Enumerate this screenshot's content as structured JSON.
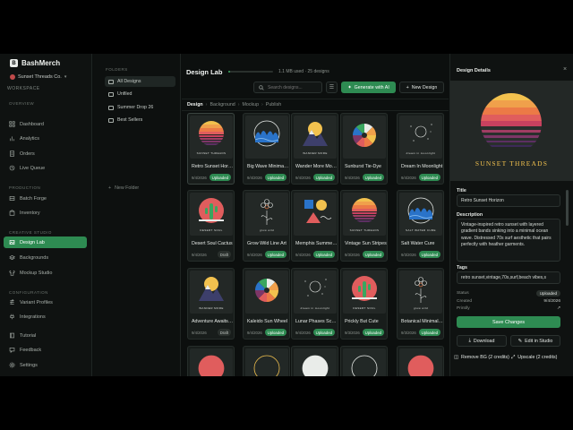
{
  "app": {
    "name": "BashMerch",
    "store": "Sunset Threads Co.",
    "workspace": "WORKSPACE"
  },
  "sidebar": {
    "sections": [
      {
        "label": "OVERVIEW",
        "items": [
          {
            "label": "Dashboard",
            "icon": "grid-icon"
          },
          {
            "label": "Analytics",
            "icon": "chart-icon"
          },
          {
            "label": "Orders",
            "icon": "orders-icon"
          },
          {
            "label": "Live Queue",
            "icon": "queue-icon"
          }
        ]
      },
      {
        "label": "PRODUCTION",
        "items": [
          {
            "label": "Batch Forge",
            "icon": "forge-icon"
          },
          {
            "label": "Inventory",
            "icon": "box-icon"
          }
        ]
      },
      {
        "label": "CREATIVE STUDIO",
        "items": [
          {
            "label": "Design Lab",
            "icon": "image-icon"
          },
          {
            "label": "Backgrounds",
            "icon": "layers-icon"
          },
          {
            "label": "Mockup Studio",
            "icon": "shirt-icon"
          }
        ]
      },
      {
        "label": "CONFIGURATION",
        "items": [
          {
            "label": "Variant Profiles",
            "icon": "sliders-icon"
          },
          {
            "label": "Integrations",
            "icon": "plug-icon"
          }
        ]
      }
    ],
    "bottom": [
      {
        "label": "Tutorial",
        "icon": "book-icon"
      },
      {
        "label": "Feedback",
        "icon": "chat-icon"
      },
      {
        "label": "Settings",
        "icon": "gear-icon"
      }
    ],
    "active": "Design Lab"
  },
  "folders": {
    "title": "FOLDERS",
    "items": [
      {
        "label": "All Designs",
        "icon": "grid-icon"
      },
      {
        "label": "Unfiled",
        "icon": "folder-icon"
      },
      {
        "label": "Summer Drop 26",
        "icon": "folder-icon"
      },
      {
        "label": "Best Sellers",
        "icon": "folder-icon"
      }
    ],
    "new_label": "New Folder"
  },
  "main": {
    "title": "Design Lab",
    "usage": "1.1 MB used · 25 designs",
    "usage_fraction": 0.03,
    "search_placeholder": "Search designs...",
    "generate_label": "Generate with AI",
    "new_design_label": "New Design",
    "breadcrumb": [
      "Design",
      "Background",
      "Mockup",
      "Publish"
    ]
  },
  "designs": [
    {
      "title": "Retro Sunset Horizon",
      "date": "9/4/2026",
      "status": "Uploaded",
      "art": "sunset",
      "caption": "SUNSET THREADS",
      "bg": "#232826"
    },
    {
      "title": "Big Wave Minimalist",
      "date": "9/4/2026",
      "status": "Uploaded",
      "art": "wave",
      "caption": "",
      "bg": "#232826"
    },
    {
      "title": "Wander More Mountains",
      "date": "9/4/2026",
      "status": "Uploaded",
      "art": "mountain",
      "caption": "WANDER MORE",
      "bg": "#232826"
    },
    {
      "title": "Sunburst Tie-Dye",
      "date": "9/4/2026",
      "status": "Uploaded",
      "art": "sunburst",
      "caption": "",
      "bg": "#232826"
    },
    {
      "title": "Dream In Moonlight",
      "date": "9/4/2026",
      "status": "Uploaded",
      "art": "moon",
      "caption": "dream in moonlight",
      "bg": "#232826"
    },
    {
      "title": "Desert Soul Cactus",
      "date": "9/4/2026",
      "status": "Draft",
      "art": "cactus",
      "caption": "DESERT SOUL",
      "bg": "#232826"
    },
    {
      "title": "Grow Wild Line Art",
      "date": "9/4/2026",
      "status": "Uploaded",
      "art": "flower",
      "caption": "grow wild",
      "bg": "#232826"
    },
    {
      "title": "Memphis Summer Shapes",
      "date": "9/4/2026",
      "status": "Uploaded",
      "art": "memphis",
      "caption": "",
      "bg": "#232826"
    },
    {
      "title": "Vintage Sun Stripes",
      "date": "9/3/2026",
      "status": "Uploaded",
      "art": "sunset",
      "caption": "SUNSET THREADS",
      "bg": "#232826"
    },
    {
      "title": "Salt Water Cure",
      "date": "9/3/2026",
      "status": "Uploaded",
      "art": "wave",
      "caption": "SALT WATER CURE",
      "bg": "#232826"
    },
    {
      "title": "Adventure Awaits Peaks",
      "date": "9/4/2026",
      "status": "Draft",
      "art": "mountain",
      "caption": "WANDER MORE",
      "bg": "#232826"
    },
    {
      "title": "Kaleido Sun Wheel",
      "date": "9/4/2026",
      "status": "Uploaded",
      "art": "sunburst",
      "caption": "",
      "bg": "#232826"
    },
    {
      "title": "Lunar Phases Script",
      "date": "9/4/2026",
      "status": "Uploaded",
      "art": "moon",
      "caption": "dream in moonlight",
      "bg": "#232826"
    },
    {
      "title": "Prickly But Cute",
      "date": "9/3/2026",
      "status": "Uploaded",
      "art": "cactus",
      "caption": "DESERT SOUL",
      "bg": "#232826"
    },
    {
      "title": "Botanical Minimal Bloom",
      "date": "9/3/2026",
      "status": "Uploaded",
      "art": "flower",
      "caption": "grow wild",
      "bg": "#232826"
    }
  ],
  "details": {
    "title": "Design Details",
    "image_caption": "SUNSET THREADS",
    "title_label": "Title",
    "title_value": "Retro Sunset Horizon",
    "description_label": "Description",
    "description_value": "Vintage-inspired retro sunset with layered gradient bands sinking into a minimal ocean wave. Distressed 70s surf aesthetic that pairs perfectly with heather garments.",
    "tags_label": "Tags",
    "tags_value": "retro sunset,vintage,70s,surf,beach vibes,s",
    "status_label": "Status",
    "status_value": "Uploaded",
    "created_label": "Created",
    "created_value": "9/4/2026",
    "printify_label": "Printify",
    "save_label": "Save Changes",
    "download_label": "Download",
    "edit_label": "Edit in Studio",
    "remove_bg_label": "Remove BG (2 credits)",
    "upscale_label": "Upscale (2 credits)"
  }
}
